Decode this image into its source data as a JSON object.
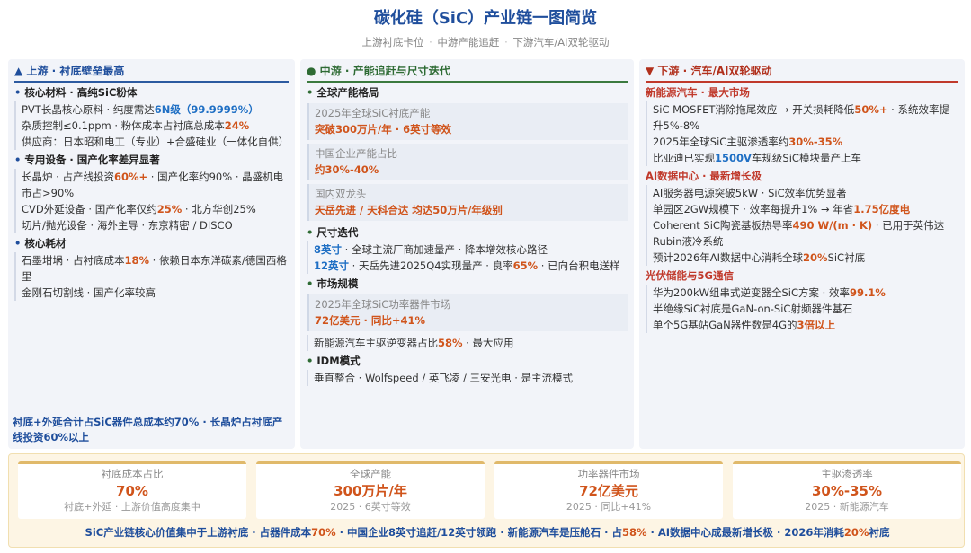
{
  "header": {
    "title": "碳化硅（SiC）产业链一图简览",
    "subtitle_parts": [
      "上游衬底卡位",
      "中游产能追赶",
      "下游汽车/AI双轮驱动"
    ]
  },
  "upstream": {
    "title": "▲ 上游 · 衬底壁垒最高",
    "sec1": {
      "title": "核心材料 · 高纯SiC粉体",
      "i1a": "PVT长晶核心原料 · 纯度需达",
      "i1b": "6N级（99.9999%）",
      "i2a": "杂质控制≤0.1ppm · 粉体成本占衬底总成本",
      "i2b": "24%",
      "i3": "供应商：日本昭和电工（专业）+合盛硅业（一体化自供）"
    },
    "sec2": {
      "title": "专用设备 · 国产化率差异显著",
      "i1a": "长晶炉 · 占产线投资",
      "i1b": "60%+",
      "i1c": " · 国产化率约90% · 晶盛机电市占>90%",
      "i2a": "CVD外延设备 · 国产化率仅约",
      "i2b": "25%",
      "i2c": " · 北方华创25%",
      "i3": "切片/抛光设备 · 海外主导 · 东京精密 / DISCO"
    },
    "sec3": {
      "title": "核心耗材",
      "i1a": "石墨坩埚 · 占衬底成本",
      "i1b": "18%",
      "i1c": " · 依赖日本东洋碳素/德国西格里",
      "i2": "金刚石切割线 · 国产化率较高"
    },
    "footer": "衬底+外延合计占SiC器件总成本约70% · 长晶炉占衬底产线投资60%以上"
  },
  "midstream": {
    "title": "● 中游 · 产能追赶与尺寸迭代",
    "sec1": {
      "title": "全球产能格局",
      "b1_label": "2025年全球SiC衬底产能",
      "b1_value": "突破300万片/年 · 6英寸等效",
      "b2_label": "中国企业产能占比",
      "b2_value": "约30%-40%",
      "b3_label": "国内双龙头",
      "b3_value": "天岳先进 / 天科合达 均达50万片/年级别"
    },
    "sec2": {
      "title": "尺寸迭代",
      "i1a": "8英寸",
      "i1b": " · 全球主流厂商加速量产 · 降本增效核心路径",
      "i2a": "12英寸",
      "i2b": " · 天岳先进2025Q4实现量产 · 良率",
      "i2c": "65%",
      "i2d": " · 已向台积电送样"
    },
    "sec3": {
      "title": "市场规模",
      "b1_label": "2025年全球SiC功率器件市场",
      "b1_value": "72亿美元 · 同比+41%",
      "i1a": "新能源汽车主驱逆变器占比",
      "i1b": "58%",
      "i1c": " · 最大应用"
    },
    "sec4": {
      "title": "IDM模式",
      "i1": "垂直整合 · Wolfspeed / 英飞凌 / 三安光电 · 是主流模式"
    }
  },
  "downstream": {
    "title": "▼ 下游 · 汽车/AI双轮驱动",
    "sec1": {
      "title": "新能源汽车 · 最大市场",
      "i1a": "SiC MOSFET消除拖尾效应 → 开关损耗降低",
      "i1b": "50%+",
      "i1c": " · 系统效率提升5%-8%",
      "i2a": "2025年全球SiC主驱渗透率约",
      "i2b": "30%-35%",
      "i3a": "比亚迪已实现",
      "i3b": "1500V",
      "i3c": "车规级SiC模块量产上车"
    },
    "sec2": {
      "title": "AI数据中心 · 最新增长极",
      "i1": "AI服务器电源突破5kW · SiC效率优势显著",
      "i2a": "单园区2GW规模下 · 效率每提升1% → 年省",
      "i2b": "1.75亿度电",
      "i3a": "Coherent SiC陶瓷基板热导率",
      "i3b": "490 W/(m · K)",
      "i3c": " · 已用于英伟达Rubin液冷系统",
      "i4a": "预计2026年AI数据中心消耗全球",
      "i4b": "20%",
      "i4c": "SiC衬底"
    },
    "sec3": {
      "title": "光伏储能与5G通信",
      "i1a": "华为200kW组串式逆变器全SiC方案 · 效率",
      "i1b": "99.1%",
      "i2": "半绝缘SiC衬底是GaN-on-SiC射频器件基石",
      "i3a": "单个5G基站GaN器件数是4G的",
      "i3b": "3倍以上"
    }
  },
  "stats": [
    {
      "label": "衬底成本占比",
      "value": "70%",
      "sub": "衬底+外延 · 上游价值高度集中"
    },
    {
      "label": "全球产能",
      "value": "300万片/年",
      "sub": "2025 · 6英寸等效"
    },
    {
      "label": "功率器件市场",
      "value": "72亿美元",
      "sub": "2025 · 同比+41%"
    },
    {
      "label": "主驱渗透率",
      "value": "30%-35%",
      "sub": "2025 · 新能源汽车"
    }
  ],
  "summary": {
    "a": "SiC产业链核心价值集中于上游衬底 · 占器件成本",
    "b": "70%",
    "c": " · 中国企业8英寸追赶/12英寸领跑 · 新能源汽车是压舱石 · 占",
    "d": "58%",
    "e": " · AI数据中心成最新增长极 · 2026年消耗",
    "f": "20%",
    "g": "衬底"
  }
}
